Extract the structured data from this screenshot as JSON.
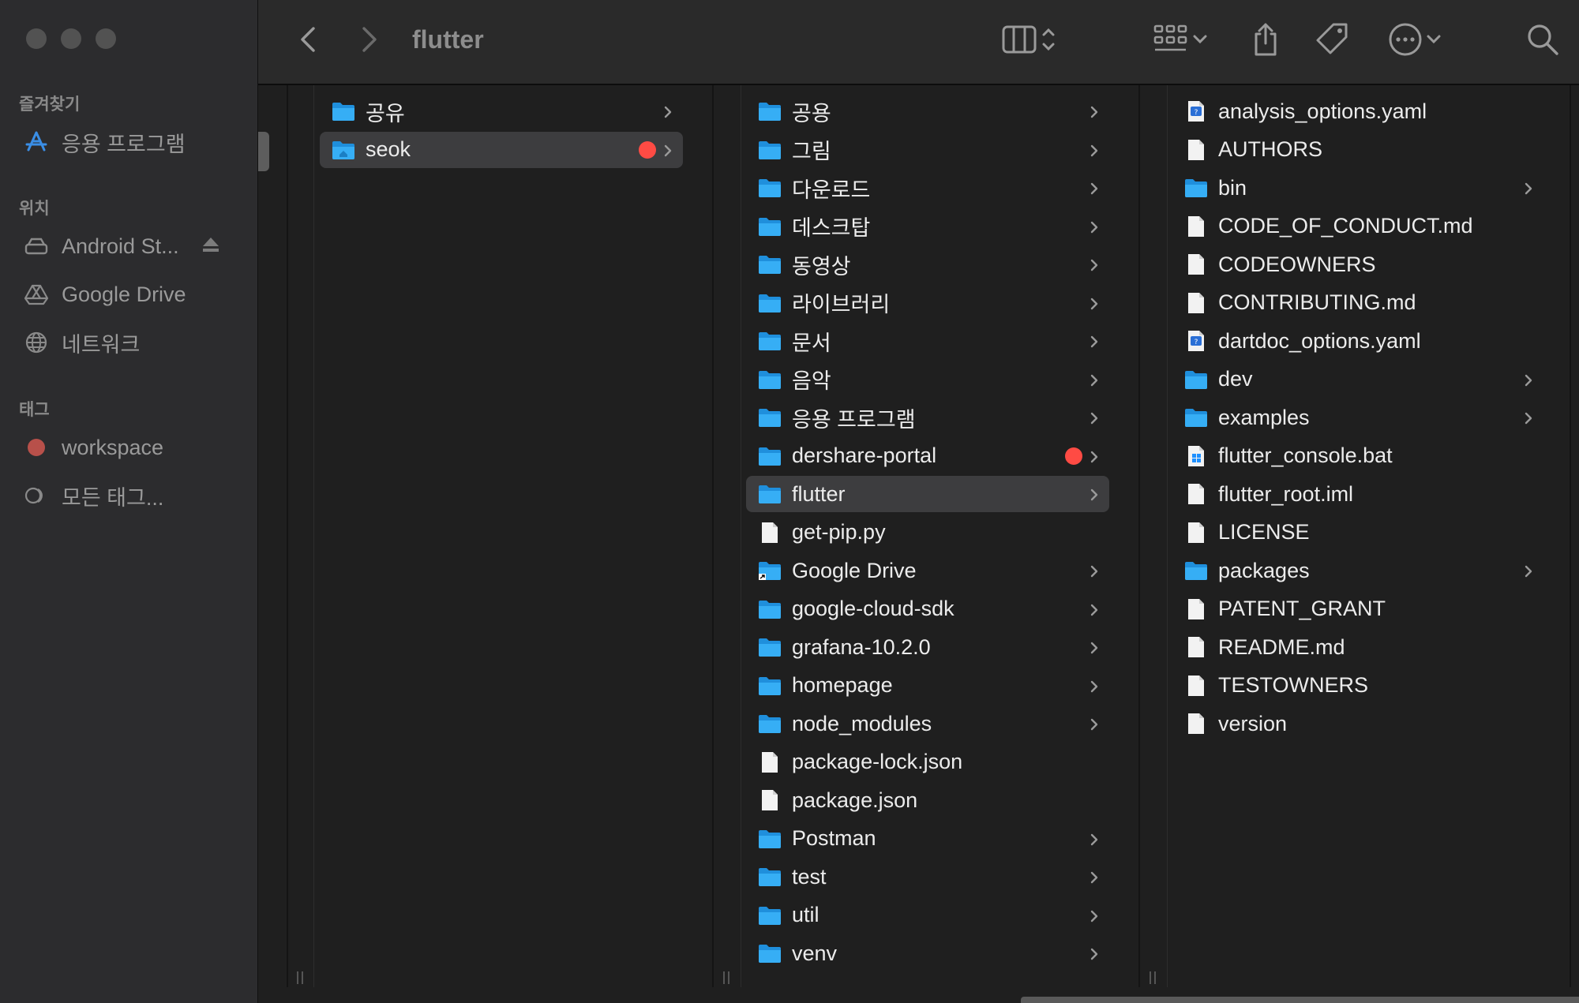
{
  "window": {
    "title": "flutter"
  },
  "sidebar": {
    "sections": [
      {
        "label": "즐겨찾기",
        "items": [
          {
            "label": "응용 프로그램",
            "icon": "apps-icon"
          }
        ]
      },
      {
        "label": "위치",
        "items": [
          {
            "label": "Android St...",
            "icon": "drive-icon"
          },
          {
            "label": "Google Drive",
            "icon": "google-drive-icon"
          },
          {
            "label": "네트워크",
            "icon": "network-icon"
          }
        ]
      },
      {
        "label": "태그",
        "items": [
          {
            "label": "workspace",
            "icon": "red-tag-icon"
          },
          {
            "label": "모든 태그...",
            "icon": "all-tags-icon"
          }
        ]
      }
    ]
  },
  "columns": [
    {
      "items": [
        {
          "name": "공유",
          "kind": "folder",
          "chevron": true
        },
        {
          "name": "seok",
          "kind": "home-folder",
          "chevron": true,
          "tag": "red",
          "selected": true
        }
      ]
    },
    {
      "items": [
        {
          "name": "공용",
          "kind": "folder",
          "chevron": true
        },
        {
          "name": "그림",
          "kind": "folder",
          "chevron": true
        },
        {
          "name": "다운로드",
          "kind": "folder",
          "chevron": true
        },
        {
          "name": "데스크탑",
          "kind": "folder",
          "chevron": true
        },
        {
          "name": "동영상",
          "kind": "folder",
          "chevron": true
        },
        {
          "name": "라이브러리",
          "kind": "folder",
          "chevron": true
        },
        {
          "name": "문서",
          "kind": "folder",
          "chevron": true
        },
        {
          "name": "음악",
          "kind": "folder",
          "chevron": true
        },
        {
          "name": "응용 프로그램",
          "kind": "folder",
          "chevron": true
        },
        {
          "name": "dershare-portal",
          "kind": "folder",
          "chevron": true,
          "tag": "red"
        },
        {
          "name": "flutter",
          "kind": "folder",
          "chevron": true,
          "selected": true
        },
        {
          "name": "get-pip.py",
          "kind": "file",
          "chevron": false
        },
        {
          "name": "Google Drive",
          "kind": "alias-folder",
          "chevron": true
        },
        {
          "name": "google-cloud-sdk",
          "kind": "folder",
          "chevron": true
        },
        {
          "name": "grafana-10.2.0",
          "kind": "folder",
          "chevron": true
        },
        {
          "name": "homepage",
          "kind": "folder",
          "chevron": true
        },
        {
          "name": "node_modules",
          "kind": "folder",
          "chevron": true
        },
        {
          "name": "package-lock.json",
          "kind": "file",
          "chevron": false
        },
        {
          "name": "package.json",
          "kind": "file",
          "chevron": false
        },
        {
          "name": "Postman",
          "kind": "folder",
          "chevron": true
        },
        {
          "name": "test",
          "kind": "folder",
          "chevron": true
        },
        {
          "name": "util",
          "kind": "folder",
          "chevron": true
        },
        {
          "name": "venv",
          "kind": "folder",
          "chevron": true
        }
      ]
    },
    {
      "items": [
        {
          "name": "analysis_options.yaml",
          "kind": "yaml",
          "chevron": false
        },
        {
          "name": "AUTHORS",
          "kind": "file",
          "chevron": false
        },
        {
          "name": "bin",
          "kind": "folder",
          "chevron": true
        },
        {
          "name": "CODE_OF_CONDUCT.md",
          "kind": "file",
          "chevron": false
        },
        {
          "name": "CODEOWNERS",
          "kind": "file",
          "chevron": false
        },
        {
          "name": "CONTRIBUTING.md",
          "kind": "file",
          "chevron": false
        },
        {
          "name": "dartdoc_options.yaml",
          "kind": "yaml",
          "chevron": false
        },
        {
          "name": "dev",
          "kind": "folder",
          "chevron": true
        },
        {
          "name": "examples",
          "kind": "folder",
          "chevron": true
        },
        {
          "name": "flutter_console.bat",
          "kind": "bat",
          "chevron": false
        },
        {
          "name": "flutter_root.iml",
          "kind": "file",
          "chevron": false
        },
        {
          "name": "LICENSE",
          "kind": "file",
          "chevron": false
        },
        {
          "name": "packages",
          "kind": "folder",
          "chevron": true
        },
        {
          "name": "PATENT_GRANT",
          "kind": "file",
          "chevron": false
        },
        {
          "name": "README.md",
          "kind": "file",
          "chevron": false
        },
        {
          "name": "TESTOWNERS",
          "kind": "file",
          "chevron": false
        },
        {
          "name": "version",
          "kind": "file",
          "chevron": false
        }
      ]
    }
  ],
  "colors": {
    "folder": "#2ea8f2",
    "tag_red": "#ff4b44",
    "selection": "#3d3d3f"
  }
}
